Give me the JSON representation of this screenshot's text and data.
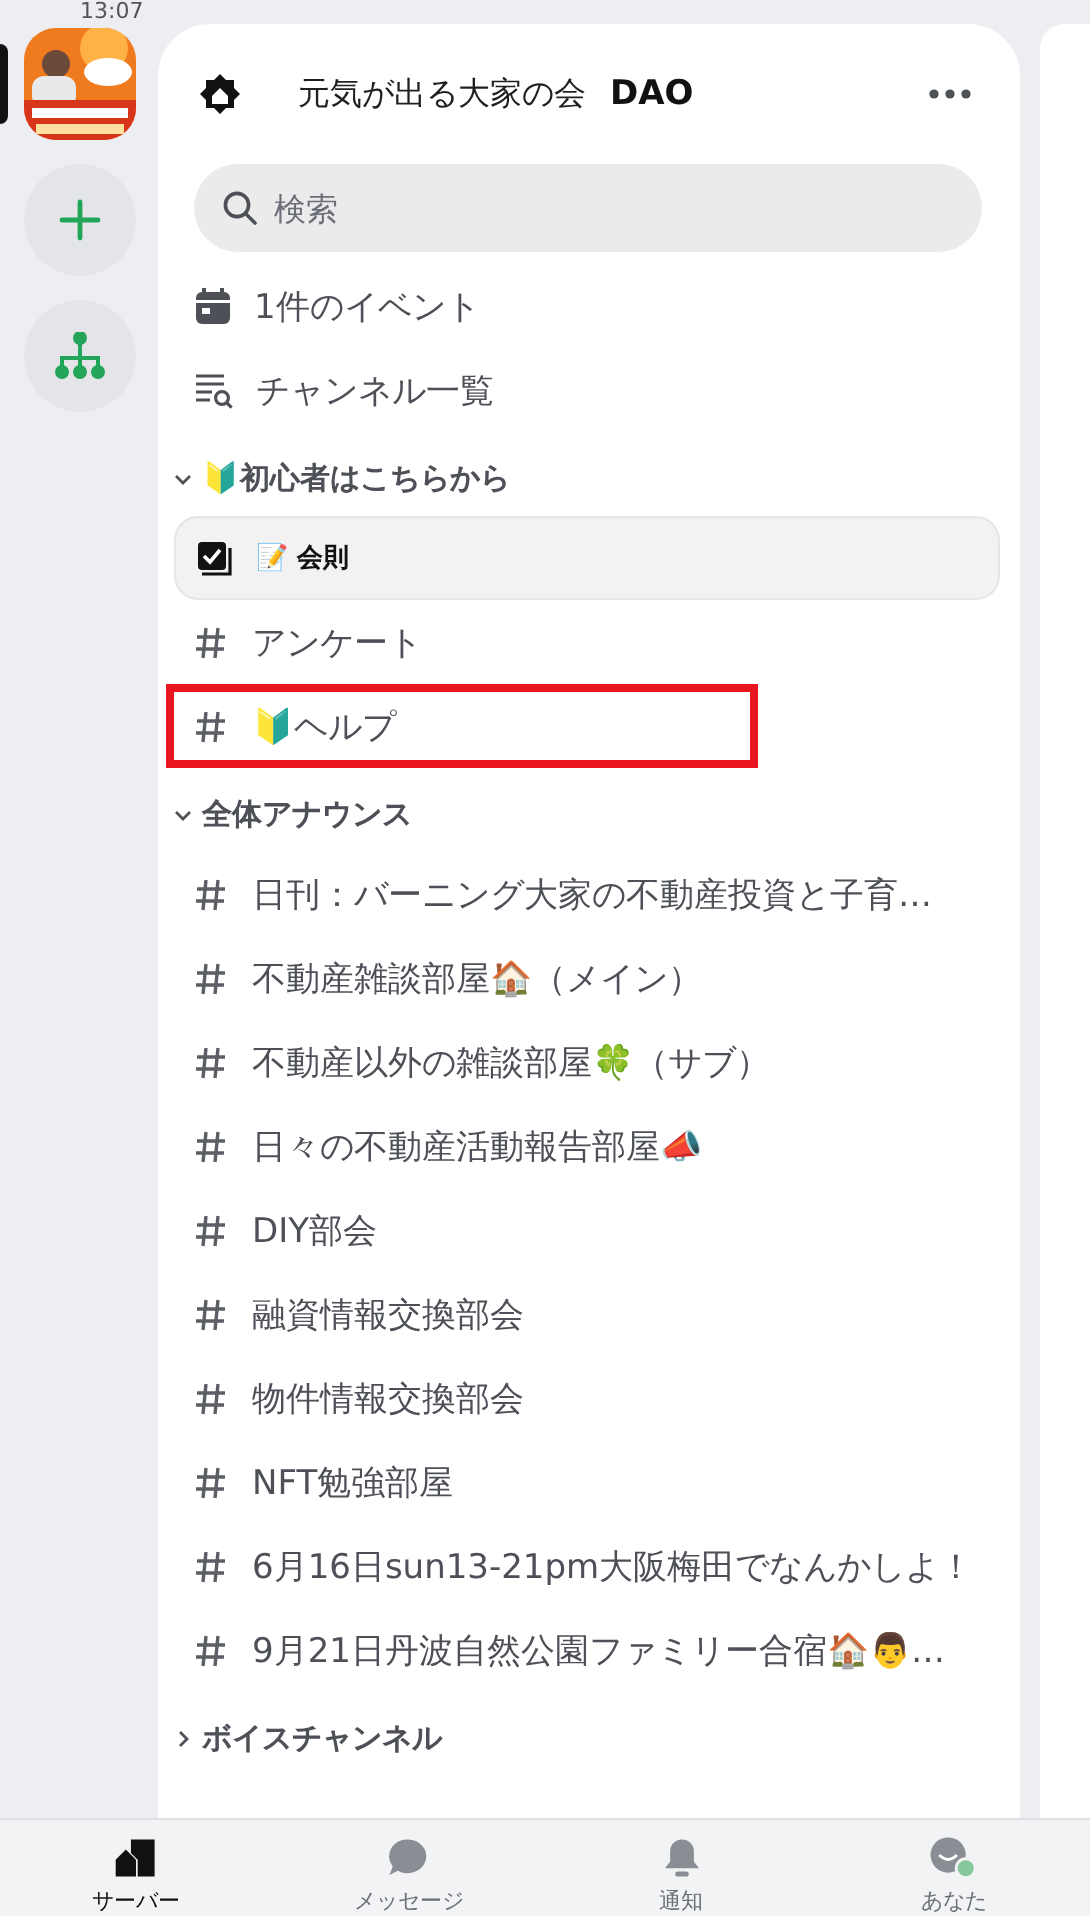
{
  "status_bar": {
    "time": "13:07"
  },
  "server_rail": {
    "items": [
      {
        "kind": "server",
        "selected": true
      },
      {
        "kind": "add"
      },
      {
        "kind": "discover"
      }
    ]
  },
  "header": {
    "server_name": "元気が出る大家の会",
    "suffix": "DAO"
  },
  "search": {
    "placeholder": "検索"
  },
  "shortcuts": [
    {
      "kind": "events",
      "label": "1件のイベント"
    },
    {
      "kind": "browse",
      "label": "チャンネル一覧"
    }
  ],
  "categories": [
    {
      "name": "🔰初心者はこちらから",
      "expanded": true,
      "channels": [
        {
          "kind": "rules",
          "name": "📝 会則",
          "selected": true,
          "highlighted": false
        },
        {
          "kind": "text",
          "name": "アンケート",
          "selected": false,
          "highlighted": false
        },
        {
          "kind": "text",
          "name": "🔰ヘルプ",
          "selected": false,
          "highlighted": true
        }
      ]
    },
    {
      "name": "全体アナウンス",
      "expanded": true,
      "channels": [
        {
          "kind": "text",
          "name": "日刊：バーニング大家の不動産投資と子育…",
          "selected": false,
          "highlighted": false
        },
        {
          "kind": "text",
          "name": "不動産雑談部屋🏠（メイン）",
          "selected": false,
          "highlighted": false
        },
        {
          "kind": "text",
          "name": "不動産以外の雑談部屋🍀（サブ）",
          "selected": false,
          "highlighted": false
        },
        {
          "kind": "text",
          "name": "日々の不動産活動報告部屋📣",
          "selected": false,
          "highlighted": false
        },
        {
          "kind": "text",
          "name": "DIY部会",
          "selected": false,
          "highlighted": false
        },
        {
          "kind": "text",
          "name": "融資情報交換部会",
          "selected": false,
          "highlighted": false
        },
        {
          "kind": "text",
          "name": "物件情報交換部会",
          "selected": false,
          "highlighted": false
        },
        {
          "kind": "text",
          "name": "NFT勉強部屋",
          "selected": false,
          "highlighted": false
        },
        {
          "kind": "text",
          "name": "6月16日sun13-21pm大阪梅田でなんかしよ！",
          "selected": false,
          "highlighted": false
        },
        {
          "kind": "text",
          "name": "9月21日丹波自然公園ファミリー合宿🏠👨…",
          "selected": false,
          "highlighted": false
        }
      ]
    },
    {
      "name": "ボイスチャンネル",
      "expanded": false
    }
  ],
  "bottom_nav": [
    {
      "kind": "servers",
      "label": "サーバー",
      "selected": true
    },
    {
      "kind": "messages",
      "label": "メッセージ",
      "selected": false
    },
    {
      "kind": "notifications",
      "label": "通知",
      "selected": false
    },
    {
      "kind": "you",
      "label": "あなた",
      "selected": false
    }
  ]
}
